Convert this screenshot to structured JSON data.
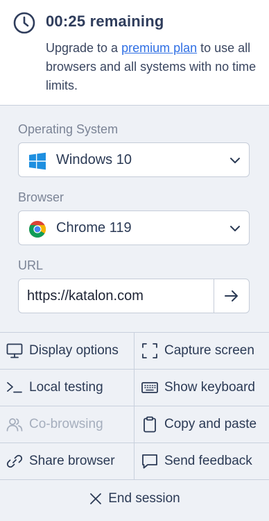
{
  "timer": {
    "remaining": "00:25 remaining",
    "message_before": "Upgrade to a ",
    "link_text": "premium plan",
    "message_after": " to use all browsers and all systems with no time limits."
  },
  "os": {
    "label": "Operating System",
    "value": "Windows 10",
    "icon": "windows-icon"
  },
  "browser": {
    "label": "Browser",
    "value": "Chrome 119",
    "icon": "chrome-icon"
  },
  "url": {
    "label": "URL",
    "value": "https://katalon.com",
    "go_icon": "arrow-right-icon"
  },
  "actions": [
    {
      "label": "Display options",
      "icon": "monitor-icon"
    },
    {
      "label": "Capture screen",
      "icon": "capture-frame-icon"
    },
    {
      "label": "Local testing",
      "icon": "terminal-icon"
    },
    {
      "label": "Show keyboard",
      "icon": "keyboard-icon"
    },
    {
      "label": "Co-browsing",
      "icon": "users-icon",
      "disabled": true
    },
    {
      "label": "Copy and paste",
      "icon": "clipboard-icon"
    },
    {
      "label": "Share browser",
      "icon": "link-icon"
    },
    {
      "label": "Send feedback",
      "icon": "message-icon"
    }
  ],
  "end_session": {
    "label": "End session",
    "icon": "close-icon"
  },
  "colors": {
    "accent_link": "#2f6fe4",
    "text": "#2b3a55",
    "muted": "#7b8496",
    "disabled": "#a5aebd",
    "panel_bg": "#eef1f6",
    "border": "#c8d0dd"
  }
}
